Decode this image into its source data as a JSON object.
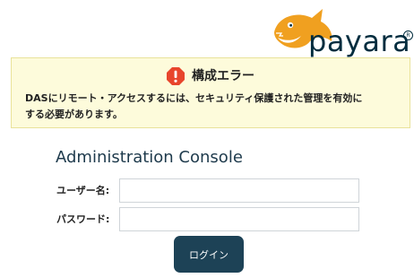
{
  "logo": {
    "wordmark": "payara",
    "registered": "R",
    "icon": "payara-fish-icon",
    "colors": {
      "fish": "#f0a020",
      "text": "#002c3e"
    }
  },
  "alert": {
    "icon": "exclamation-icon",
    "title": "構成エラー",
    "message_line1": "DASにリモート・アクセスするには、セキュリティ保護された管理を有効に",
    "message_line2": "する必要があります。",
    "colors": {
      "background": "#fdfbdb",
      "icon": "#e8452c"
    }
  },
  "console": {
    "title": "Administration Console",
    "username_label": "ユーザー名:",
    "username_value": "",
    "password_label": "パスワード:",
    "password_value": "",
    "login_label": "ログイン",
    "colors": {
      "button": "#1d4256",
      "title": "#1e3a4c"
    }
  }
}
